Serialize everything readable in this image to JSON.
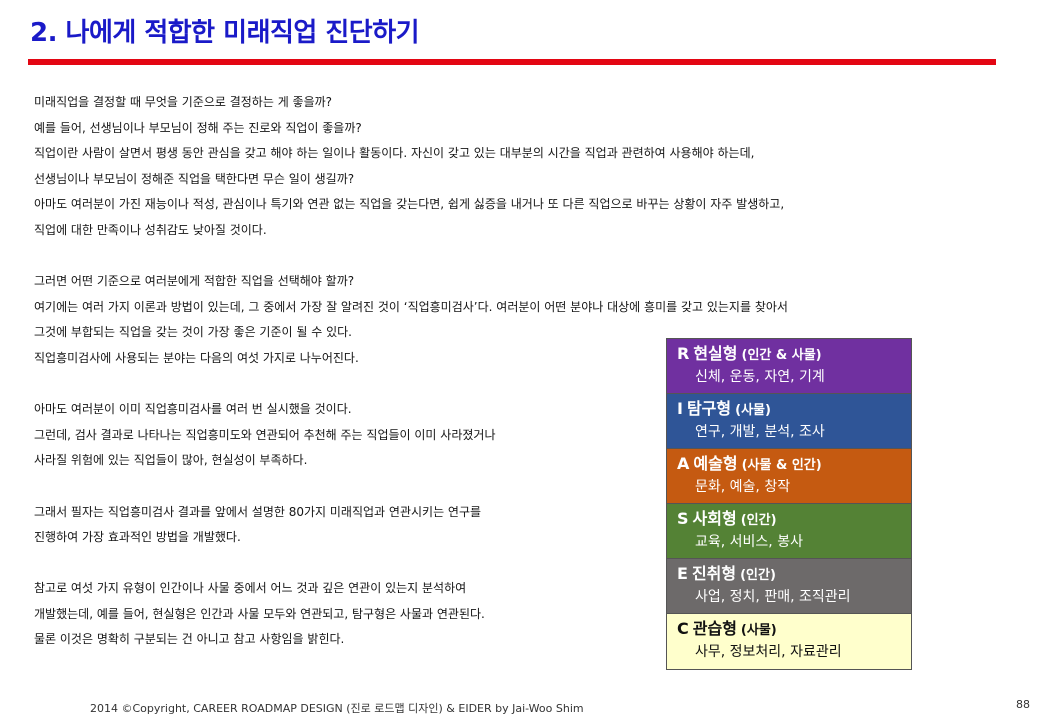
{
  "title": "2. 나에게 적합한 미래직업 진단하기",
  "paragraphs": [
    "미래직업을 결정할 때 무엇을 기준으로 결정하는 게 좋을까?",
    "예를 들어, 선생님이나 부모님이 정해 주는 진로와 직업이 좋을까?",
    "직업이란 사람이 살면서 평생 동안 관심을 갖고 해야 하는 일이나 활동이다. 자신이 갖고 있는 대부분의 시간을 직업과 관련하여 사용해야 하는데,",
    "선생님이나 부모님이 정해준 직업을 택한다면 무슨 일이 생길까?",
    "아마도 여러분이 가진 재능이나 적성, 관심이나 특기와 연관 없는 직업을 갖는다면, 쉽게 싫증을 내거나 또 다른 직업으로 바꾸는 상황이 자주 발생하고,",
    "직업에 대한 만족이나 성취감도 낮아질 것이다.",
    "",
    "그러면 어떤 기준으로 여러분에게 적합한 직업을 선택해야 할까?",
    "여기에는 여러 가지 이론과 방법이 있는데, 그 중에서 가장 잘 알려진 것이 ‘직업흥미검사’다. 여러분이 어떤 분야나 대상에 흥미를 갖고 있는지를 찾아서",
    "그것에 부합되는 직업을 갖는 것이 가장 좋은 기준이 될 수 있다.",
    "직업흥미검사에 사용되는 분야는 다음의 여섯 가지로 나누어진다.",
    "",
    "아마도 여러분이 이미 직업흥미검사를 여러 번 실시했을 것이다.",
    "그런데, 검사 결과로 나타나는 직업흥미도와 연관되어 추천해 주는 직업들이 이미 사라졌거나",
    "사라질 위험에 있는 직업들이 많아, 현실성이 부족하다.",
    "",
    "그래서 필자는 직업흥미검사 결과를 앞에서 설명한 80가지 미래직업과 연관시키는 연구를",
    "진행하여 가장 효과적인 방법을 개발했다.",
    "",
    "참고로 여섯 가지 유형이 인간이나 사물 중에서 어느 것과 깊은 연관이 있는지 분석하여",
    "개발했는데, 예를 들어, 현실형은 인간과 사물 모두와 연관되고, 탐구형은 사물과 연관된다.",
    "물론 이것은 명확히 구분되는 건 아니고 참고 사항임을 밝힌다."
  ],
  "interest_types": [
    {
      "code": "R",
      "name": "현실형",
      "relation": "(인간 & 사물)",
      "desc": "신체, 운동, 자연, 기계",
      "bg": "#7030a0",
      "fg": "#ffffff"
    },
    {
      "code": "I",
      "name": "탐구형",
      "relation": "(사물)",
      "desc": "연구, 개발, 분석, 조사",
      "bg": "#2f5597",
      "fg": "#ffffff"
    },
    {
      "code": "A",
      "name": "예술형",
      "relation": "(사물 & 인간)",
      "desc": "문화, 예술, 창작",
      "bg": "#c55a11",
      "fg": "#ffffff"
    },
    {
      "code": "S",
      "name": "사회형",
      "relation": "(인간)",
      "desc": "교육, 서비스, 봉사",
      "bg": "#548235",
      "fg": "#ffffff"
    },
    {
      "code": "E",
      "name": "진취형",
      "relation": "(인간)",
      "desc": "사업, 정치, 판매, 조직관리",
      "bg": "#6d6a6a",
      "fg": "#ffffff"
    },
    {
      "code": "C",
      "name": "관습형",
      "relation": "(사물)",
      "desc": "사무, 정보처리, 자료관리",
      "bg": "#ffffcc",
      "fg": "#111111"
    }
  ],
  "footer": "2014 ©Copyright, CAREER ROADMAP DESIGN (진로 로드맵 디자인) & EIDER by Jai-Woo Shim",
  "page_number": "88",
  "colors": {
    "title": "#1a1ac8",
    "rule": "#e30613"
  }
}
